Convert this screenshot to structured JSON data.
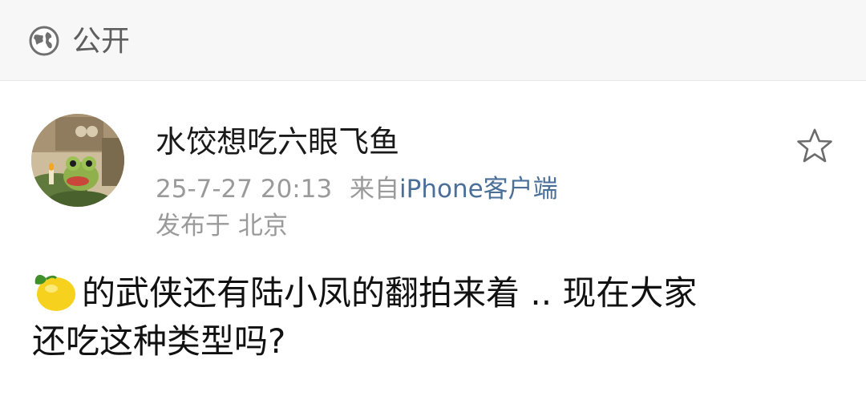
{
  "header": {
    "visibility_icon": "globe-icon",
    "visibility_label": "公开"
  },
  "post": {
    "author": {
      "name": "水饺想吃六眼飞鱼",
      "avatar_icon": "frog-avatar"
    },
    "date": "25-7-27 20:13",
    "source_prefix": "来自",
    "source_app": "iPhone客户端",
    "location": "发布于 北京",
    "favorite_icon": "star-outline-icon",
    "emoji": "lemon-emoji",
    "text_line1": "的武侠还有陆小凤的翻拍来着 .. 现在大家",
    "text_line2": "还吃这种类型吗?"
  },
  "colors": {
    "header_bg": "#f7f7f7",
    "link": "#4a6f99",
    "meta": "#9a9a9a"
  }
}
